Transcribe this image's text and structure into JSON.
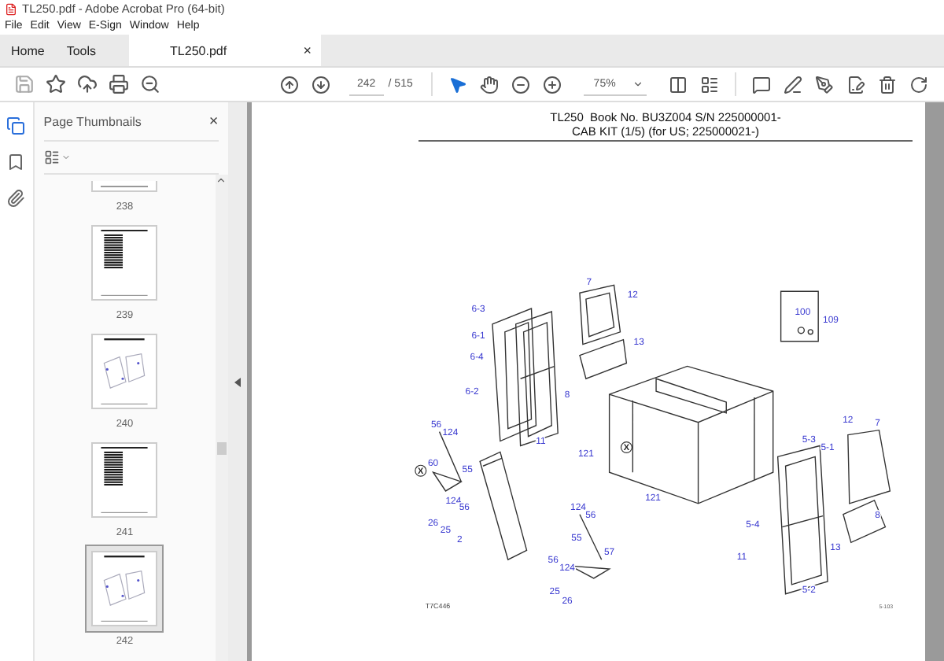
{
  "window": {
    "title": "TL250.pdf - Adobe Acrobat Pro (64-bit)"
  },
  "menu": [
    "File",
    "Edit",
    "View",
    "E-Sign",
    "Window",
    "Help"
  ],
  "tabs": [
    {
      "label": "Home",
      "selected": false,
      "kind": "nav"
    },
    {
      "label": "Tools",
      "selected": false,
      "kind": "nav"
    },
    {
      "label": "TL250.pdf",
      "selected": true,
      "kind": "document",
      "close": "×"
    }
  ],
  "toolbar": {
    "page": "242",
    "total": "/ 515",
    "zoom": "75%"
  },
  "sidebar": {
    "title": "Page Thumbnails",
    "close": "×",
    "thumbnails": [
      {
        "label": "238",
        "kind": "cut",
        "selected": false
      },
      {
        "label": "239",
        "kind": "table",
        "selected": false
      },
      {
        "label": "240",
        "kind": "diagram",
        "selected": false
      },
      {
        "label": "241",
        "kind": "table",
        "selected": false
      },
      {
        "label": "242",
        "kind": "diagram",
        "selected": true
      }
    ]
  },
  "page": {
    "header": [
      "TL250  Book No. BU3Z004 S/N 225000001-",
      "CAB KIT (1/5) (for US; 225000021-)"
    ],
    "callouts": [
      {
        "label": "6-3",
        "kind": "plain"
      },
      {
        "label": "7",
        "kind": "plain"
      },
      {
        "label": "12",
        "kind": "plain"
      },
      {
        "label": "6-1",
        "kind": "plain"
      },
      {
        "label": "13",
        "kind": "plain"
      },
      {
        "label": "6-4",
        "kind": "plain"
      },
      {
        "label": "6-2",
        "kind": "plain"
      },
      {
        "label": "8",
        "kind": "plain"
      },
      {
        "label": "11",
        "kind": "plain"
      },
      {
        "label": "100",
        "kind": "plain"
      },
      {
        "label": "109",
        "kind": "plain"
      },
      {
        "label": "56",
        "kind": "plain"
      },
      {
        "label": "124",
        "kind": "plain"
      },
      {
        "label": "60",
        "kind": "plain"
      },
      {
        "label": "55",
        "kind": "plain"
      },
      {
        "label": "X",
        "kind": "circled"
      },
      {
        "label": "124",
        "kind": "plain"
      },
      {
        "label": "56",
        "kind": "plain"
      },
      {
        "label": "26",
        "kind": "plain"
      },
      {
        "label": "25",
        "kind": "plain"
      },
      {
        "label": "2",
        "kind": "plain"
      },
      {
        "label": "121",
        "kind": "plain"
      },
      {
        "label": "X",
        "kind": "circled"
      },
      {
        "label": "121",
        "kind": "plain"
      },
      {
        "label": "5-3",
        "kind": "plain"
      },
      {
        "label": "5-1",
        "kind": "plain"
      },
      {
        "label": "12",
        "kind": "plain"
      },
      {
        "label": "7",
        "kind": "plain"
      },
      {
        "label": "5-4",
        "kind": "plain"
      },
      {
        "label": "11",
        "kind": "plain"
      },
      {
        "label": "5-2",
        "kind": "plain"
      },
      {
        "label": "13",
        "kind": "plain"
      },
      {
        "label": "8",
        "kind": "plain"
      },
      {
        "label": "124",
        "kind": "plain"
      },
      {
        "label": "56",
        "kind": "plain"
      },
      {
        "label": "55",
        "kind": "plain"
      },
      {
        "label": "57",
        "kind": "plain"
      },
      {
        "label": "56",
        "kind": "plain"
      },
      {
        "label": "124",
        "kind": "plain"
      },
      {
        "label": "25",
        "kind": "plain"
      },
      {
        "label": "26",
        "kind": "plain"
      }
    ],
    "drawing_code": "T7C446",
    "page_code": "5-103"
  }
}
